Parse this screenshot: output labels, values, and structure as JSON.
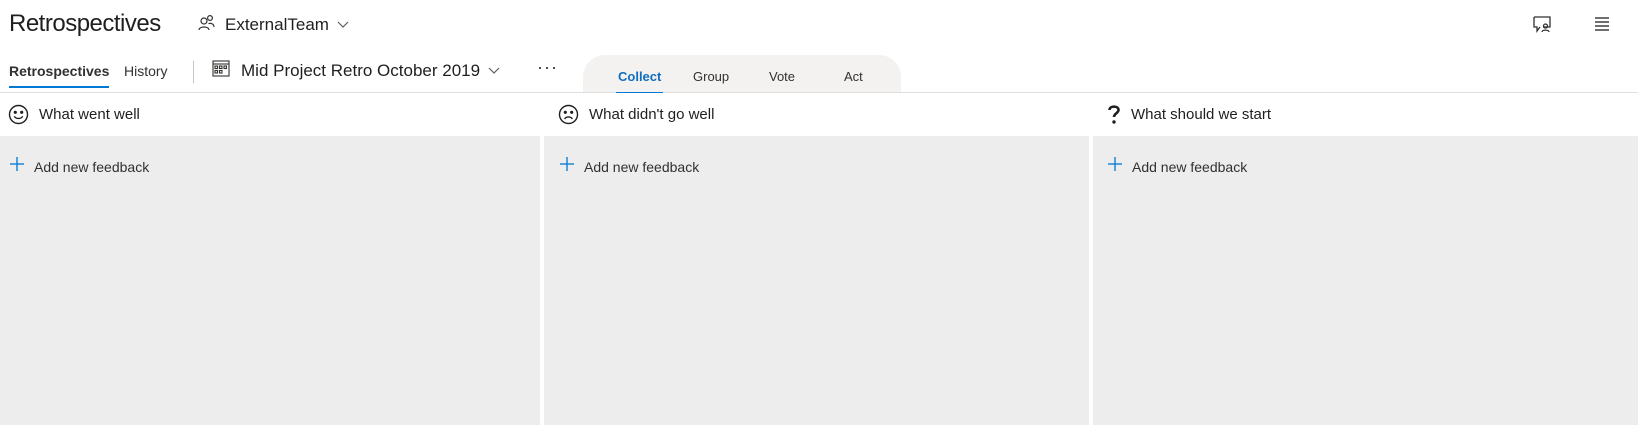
{
  "header": {
    "title": "Retrospectives",
    "team": {
      "name": "ExternalTeam",
      "icon": "people-icon"
    },
    "actions": [
      {
        "icon": "feedback-icon"
      },
      {
        "icon": "menu-icon"
      }
    ]
  },
  "pivot": {
    "tabs": [
      {
        "label": "Retrospectives",
        "active": true
      },
      {
        "label": "History",
        "active": false
      }
    ],
    "board": {
      "name": "Mid Project Retro October 2019",
      "icon": "board-icon"
    },
    "more_label": "···"
  },
  "phases": {
    "tabs": [
      {
        "label": "Collect",
        "active": true
      },
      {
        "label": "Group",
        "active": false
      },
      {
        "label": "Vote",
        "active": false
      },
      {
        "label": "Act",
        "active": false
      }
    ]
  },
  "columns": [
    {
      "title": "What went well",
      "icon": "smile-icon",
      "add_label": "Add new feedback"
    },
    {
      "title": "What didn't go well",
      "icon": "frown-icon",
      "add_label": "Add new feedback"
    },
    {
      "title": "What should we start",
      "icon": "question-icon",
      "add_label": "Add new feedback"
    }
  ],
  "colors": {
    "accent": "#0078d4",
    "column_bg": "#ededed",
    "text": "#201f1e"
  }
}
